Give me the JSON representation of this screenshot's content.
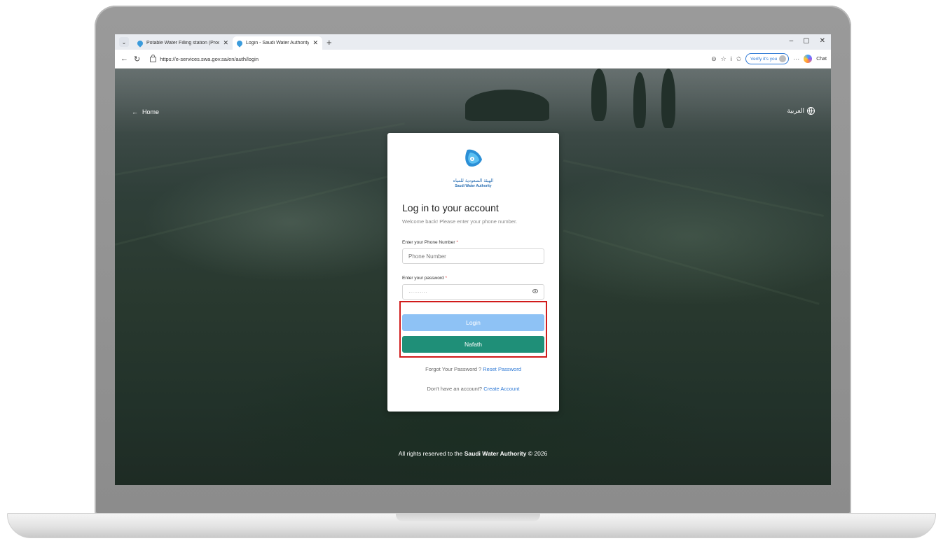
{
  "browser": {
    "tabs": [
      {
        "title": "Potable Water Filling station (Proc",
        "active": false
      },
      {
        "title": "Login - Saudi Water Authority",
        "active": true
      }
    ],
    "new_tab_symbol": "+",
    "window_controls": [
      "–",
      "▢",
      "✕"
    ],
    "url": "https://e-services.swa.gov.sa/en/auth/login",
    "verify_label": "Verify it's you",
    "chat_label": "Chat"
  },
  "page": {
    "home_link": "Home",
    "language_link": "العربية",
    "logo_arabic": "الهيئة السعودية للمياه",
    "logo_english": "Saudi Water Authority",
    "title": "Log in to your account",
    "subtitle": "Welcome back! Please enter your phone number.",
    "phone_label": "Enter your Phone Number",
    "phone_placeholder": "Phone Number",
    "password_label": "Enter your password",
    "password_placeholder": "··········",
    "login_button": "Login",
    "nafath_button": "Nafath",
    "forgot_text": "Forgot Your Password ?",
    "reset_link": "Reset Password",
    "no_account_text": "Don't have an account?",
    "create_account_link": "Create Account",
    "footer_prefix": "All rights reserved to the",
    "footer_org": "Saudi Water Authority",
    "footer_suffix": "© 2026"
  },
  "colors": {
    "login_button": "#8ec2f5",
    "nafath_button": "#1f8f78",
    "highlight": "#d11b1b",
    "link": "#2f7ad6"
  }
}
